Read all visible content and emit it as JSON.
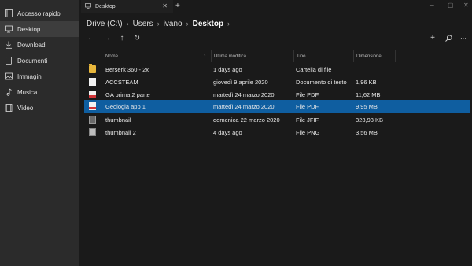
{
  "window": {
    "tab_title": "Desktop",
    "tab_close": "✕",
    "new_tab": "+",
    "controls": [
      "─",
      "▢",
      "✕"
    ]
  },
  "breadcrumb": [
    "Drive (C:\\)",
    "Users",
    "ivano",
    "Desktop"
  ],
  "breadcrumb_sep": "›",
  "sidebar": {
    "items": [
      {
        "label": "Accesso rapido",
        "icon": "star-icon",
        "active": false
      },
      {
        "label": "Desktop",
        "icon": "desktop-icon",
        "active": true
      },
      {
        "label": "Download",
        "icon": "download-icon",
        "active": false
      },
      {
        "label": "Documenti",
        "icon": "document-icon",
        "active": false
      },
      {
        "label": "Immagini",
        "icon": "image-icon",
        "active": false
      },
      {
        "label": "Musica",
        "icon": "music-icon",
        "active": false
      },
      {
        "label": "Video",
        "icon": "video-icon",
        "active": false
      }
    ]
  },
  "toolbar": {
    "back": "←",
    "forward": "→",
    "up": "↑",
    "refresh": "↻",
    "new": "+",
    "search": "⌕",
    "more": "···"
  },
  "columns": {
    "name": "Nome",
    "modified": "Ultima modifica",
    "type": "Tipo",
    "size": "Dimensione",
    "sort_arrow": "↑"
  },
  "files": [
    {
      "name": "Berserk 360 - 2x",
      "modified": "1 days ago",
      "type": "Cartella di file",
      "size": "",
      "icon": "folder-icon",
      "selected": false
    },
    {
      "name": "ACCSTEAM",
      "modified": "giovedì 9 aprile 2020",
      "type": "Documento di testo",
      "size": "1,96 KB",
      "icon": "document-icon",
      "selected": false
    },
    {
      "name": "GA prima 2 parte",
      "modified": "martedì 24 marzo 2020",
      "type": "File PDF",
      "size": "11,62 MB",
      "icon": "pdf-icon",
      "selected": false
    },
    {
      "name": "Geologia app 1",
      "modified": "martedì 24 marzo 2020",
      "type": "File PDF",
      "size": "9,95 MB",
      "icon": "pdf-icon",
      "selected": true
    },
    {
      "name": "thumbnail",
      "modified": "domenica 22 marzo 2020",
      "type": "File JFIF",
      "size": "323,93 KB",
      "icon": "image-icon",
      "selected": false
    },
    {
      "name": "thumbnail 2",
      "modified": "4 days ago",
      "type": "File PNG",
      "size": "3,56 MB",
      "icon": "image-icon",
      "selected": false
    }
  ],
  "colors": {
    "selection": "#0f5ea0",
    "sidebar_bg": "#2b2b2b",
    "main_bg": "#1a1a1a",
    "folder": "#e8b73c",
    "pdf": "#d13438"
  }
}
